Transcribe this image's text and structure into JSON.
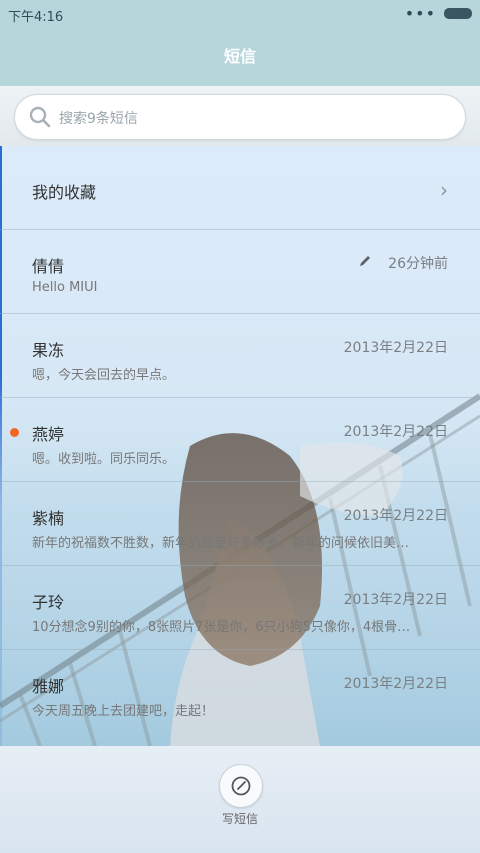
{
  "status_bar": {
    "time": "下午4:16",
    "dots": "•••"
  },
  "title": "短信",
  "search": {
    "placeholder": "搜索9条短信"
  },
  "favorites": {
    "label": "我的收藏",
    "chevron": "›"
  },
  "conversations": [
    {
      "name": "倩倩",
      "preview": "Hello MIUI",
      "time": "26分钟前",
      "draft": true,
      "unread": false
    },
    {
      "name": "果冻",
      "preview": "嗯，今天会回去的早点。",
      "time": "2013年2月22日",
      "unread": false
    },
    {
      "name": "燕婷",
      "preview": "嗯。收到啦。同乐同乐。",
      "time": "2013年2月22日",
      "unread": true
    },
    {
      "name": "紫楠",
      "preview": "新年的祝福数不胜数，新年的愿望好多好多，新年的问候依旧美…",
      "time": "2013年2月22日",
      "unread": false
    },
    {
      "name": "子玲",
      "preview": "10分想念9别的你，8张照片7张是你，6只小狗5只像你，4根骨…",
      "time": "2013年2月22日",
      "unread": false
    },
    {
      "name": "雅娜",
      "preview": "今天周五晚上去团建吧，走起！",
      "time": "2013年2月22日",
      "unread": false
    }
  ],
  "footer": {
    "compose_label": "写短信"
  },
  "colors": {
    "accent_dot": "#f26522",
    "title_bar": "#b6d6dc",
    "edge_line": "#2b6dd8"
  },
  "icons": [
    "search-icon",
    "chevron-right-icon",
    "pencil-icon",
    "compose-icon",
    "battery-icon"
  ]
}
